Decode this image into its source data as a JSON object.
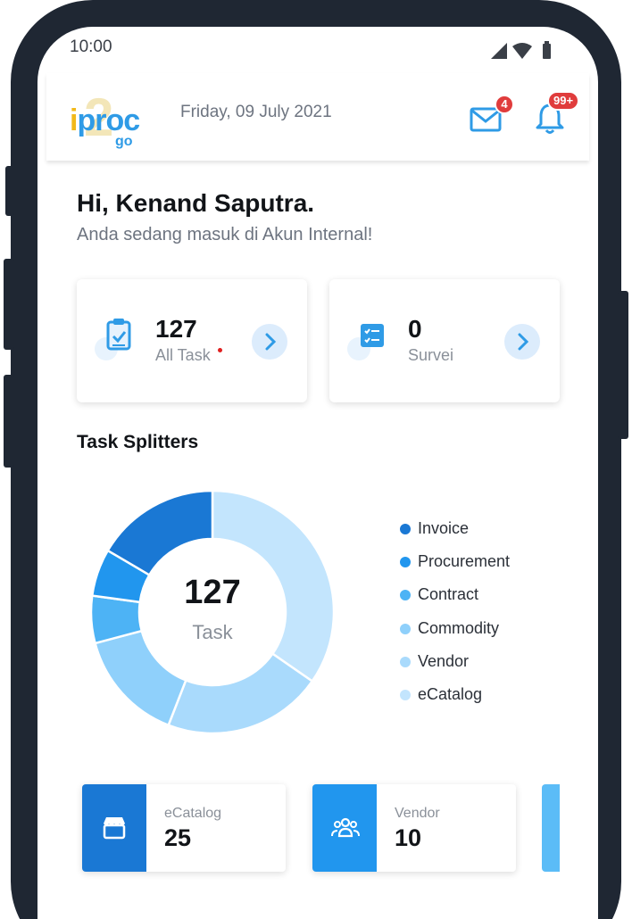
{
  "status_bar": {
    "time": "10:00"
  },
  "header": {
    "logo": {
      "word_i": "i",
      "word_rest": "proc",
      "sub": "go",
      "ghost": "2"
    },
    "date": "Friday, 09 July 2021",
    "mail_badge": "4",
    "notification_badge": "99+"
  },
  "greeting": {
    "title": "Hi, Kenand Saputra.",
    "subtitle": "Anda sedang masuk di Akun Internal!"
  },
  "summary_cards": [
    {
      "value": "127",
      "label": "All Task",
      "icon": "clipboard-check-icon"
    },
    {
      "value": "0",
      "label": "Survei",
      "icon": "checklist-icon"
    }
  ],
  "task_splitters": {
    "title": "Task Splitters",
    "center_value": "127",
    "center_label": "Task"
  },
  "chart_data": {
    "type": "pie",
    "donut": true,
    "total": 127,
    "categories": [
      "Invoice",
      "Procurement",
      "Contract",
      "Commodity",
      "Vendor",
      "eCatalog"
    ],
    "values": [
      21,
      8,
      8,
      19,
      27,
      44
    ],
    "colors": [
      "#1a78d4",
      "#2196ee",
      "#4db3f5",
      "#8fd0fb",
      "#a9dafc",
      "#c3e5fd"
    ],
    "legend_position": "right"
  },
  "tiles": [
    {
      "label": "eCatalog",
      "value": "25",
      "color": "#1a78d4",
      "icon": "store-icon"
    },
    {
      "label": "Vendor",
      "value": "10",
      "color": "#2196ee",
      "icon": "users-icon"
    }
  ],
  "colors": {
    "accent": "#2f9be6",
    "badge": "#e03c3c",
    "frame": "#1f2733"
  }
}
